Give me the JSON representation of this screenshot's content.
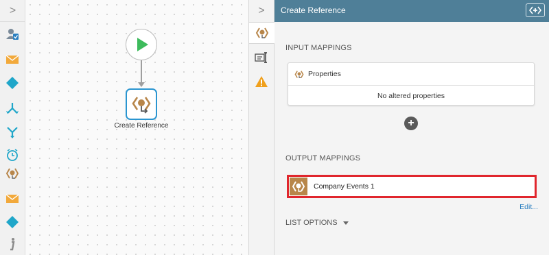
{
  "toolbox": {
    "collapse_glyph": ">",
    "items": [
      {
        "name": "assign-user-icon"
      },
      {
        "name": "email-icon"
      },
      {
        "name": "decision-icon"
      },
      {
        "name": "split-icon"
      },
      {
        "name": "merge-icon"
      },
      {
        "name": "timer-icon"
      },
      {
        "name": "reference-icon"
      },
      {
        "name": "email-icon"
      },
      {
        "name": "decision-icon"
      },
      {
        "name": "info-icon"
      }
    ]
  },
  "canvas": {
    "action_node_label": "Create Reference"
  },
  "side_tabs": {
    "collapse_glyph": ">",
    "tabs": [
      {
        "name": "reference-tab-icon",
        "active": true
      },
      {
        "name": "text-field-tab-icon",
        "active": false
      },
      {
        "name": "warning-tab-icon",
        "active": false
      }
    ]
  },
  "panel": {
    "title": "Create Reference",
    "input_mappings_title": "INPUT MAPPINGS",
    "properties_label": "Properties",
    "no_properties_text": "No altered properties",
    "add_glyph": "+",
    "output_mappings_title": "OUTPUT MAPPINGS",
    "output_item_label": "Company Events 1",
    "edit_link": "Edit...",
    "list_options_label": "LIST OPTIONS"
  },
  "colors": {
    "header_bg": "#4f7f98",
    "accent_blue": "#2a95d0",
    "start_green": "#3dbb5c",
    "reference_brown": "#b8864a",
    "highlight_red": "#e0262d",
    "warning_orange": "#f0a01c",
    "decision_teal": "#1fa6c9"
  }
}
